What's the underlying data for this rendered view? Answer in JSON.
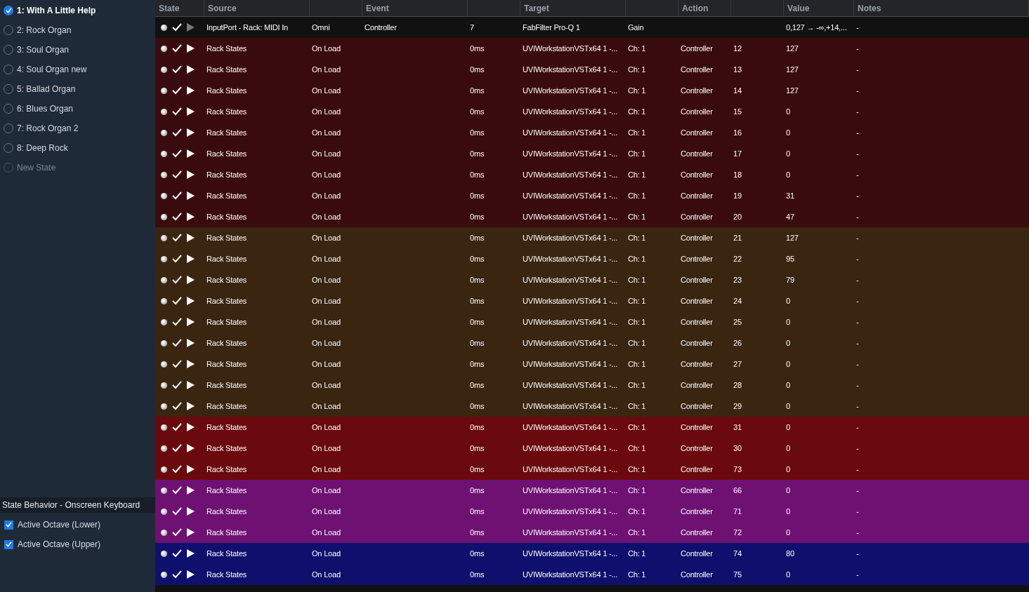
{
  "states": [
    {
      "label": "1: With A Little Help",
      "selected": true,
      "kind": "state"
    },
    {
      "label": "2: Rock Organ",
      "selected": false,
      "kind": "state"
    },
    {
      "label": "3: Soul Organ",
      "selected": false,
      "kind": "state"
    },
    {
      "label": "4: Soul Organ new",
      "selected": false,
      "kind": "state"
    },
    {
      "label": "5: Ballad Organ",
      "selected": false,
      "kind": "state"
    },
    {
      "label": "6: Blues Organ",
      "selected": false,
      "kind": "state"
    },
    {
      "label": "7: Rock Organ 2",
      "selected": false,
      "kind": "state"
    },
    {
      "label": "8: Deep Rock",
      "selected": false,
      "kind": "state"
    },
    {
      "label": "New State",
      "selected": false,
      "kind": "new"
    }
  ],
  "behavior": {
    "title": "State Behavior - Onscreen Keyboard",
    "options": [
      {
        "label": "Active Octave (Lower)",
        "checked": true
      },
      {
        "label": "Active Octave (Upper)",
        "checked": true
      }
    ]
  },
  "table": {
    "columns": [
      "State",
      "Source",
      "",
      "Event",
      "",
      "Target",
      "",
      "Action",
      "",
      "Value",
      "Notes"
    ],
    "rows": [
      {
        "color": "#111111",
        "playable": false,
        "cells": [
          "",
          "InputPort - Rack: MIDI In",
          "Omni",
          "Controller",
          "7",
          "FabFilter Pro-Q 1",
          "Gain",
          "",
          "",
          "0,127 → -∞,+14,...",
          "-"
        ]
      },
      {
        "color": "#3a0b0e",
        "playable": true,
        "cells": [
          "",
          "Rack States",
          "On Load",
          "",
          "0ms",
          "UVIWorkstationVSTx64 1 -...",
          "Ch: 1",
          "Controller",
          "12",
          "127",
          "-"
        ]
      },
      {
        "color": "#3a0b0e",
        "playable": true,
        "cells": [
          "",
          "Rack States",
          "On Load",
          "",
          "0ms",
          "UVIWorkstationVSTx64 1 -...",
          "Ch: 1",
          "Controller",
          "13",
          "127",
          "-"
        ]
      },
      {
        "color": "#3a0b0e",
        "playable": true,
        "cells": [
          "",
          "Rack States",
          "On Load",
          "",
          "0ms",
          "UVIWorkstationVSTx64 1 -...",
          "Ch: 1",
          "Controller",
          "14",
          "127",
          "-"
        ]
      },
      {
        "color": "#3a0b0e",
        "playable": true,
        "cells": [
          "",
          "Rack States",
          "On Load",
          "",
          "0ms",
          "UVIWorkstationVSTx64 1 -...",
          "Ch: 1",
          "Controller",
          "15",
          "0",
          "-"
        ]
      },
      {
        "color": "#3a0b0e",
        "playable": true,
        "cells": [
          "",
          "Rack States",
          "On Load",
          "",
          "0ms",
          "UVIWorkstationVSTx64 1 -...",
          "Ch: 1",
          "Controller",
          "16",
          "0",
          "-"
        ]
      },
      {
        "color": "#3a0b0e",
        "playable": true,
        "cells": [
          "",
          "Rack States",
          "On Load",
          "",
          "0ms",
          "UVIWorkstationVSTx64 1 -...",
          "Ch: 1",
          "Controller",
          "17",
          "0",
          "-"
        ]
      },
      {
        "color": "#3a0b0e",
        "playable": true,
        "cells": [
          "",
          "Rack States",
          "On Load",
          "",
          "0ms",
          "UVIWorkstationVSTx64 1 -...",
          "Ch: 1",
          "Controller",
          "18",
          "0",
          "-"
        ]
      },
      {
        "color": "#3a0b0e",
        "playable": true,
        "cells": [
          "",
          "Rack States",
          "On Load",
          "",
          "0ms",
          "UVIWorkstationVSTx64 1 -...",
          "Ch: 1",
          "Controller",
          "19",
          "31",
          "-"
        ]
      },
      {
        "color": "#3a0b0e",
        "playable": true,
        "cells": [
          "",
          "Rack States",
          "On Load",
          "",
          "0ms",
          "UVIWorkstationVSTx64 1 -...",
          "Ch: 1",
          "Controller",
          "20",
          "47",
          "-"
        ]
      },
      {
        "color": "#3a2511",
        "playable": true,
        "cells": [
          "",
          "Rack States",
          "On Load",
          "",
          "0ms",
          "UVIWorkstationVSTx64 1 -...",
          "Ch: 1",
          "Controller",
          "21",
          "127",
          "-"
        ]
      },
      {
        "color": "#3a2511",
        "playable": true,
        "cells": [
          "",
          "Rack States",
          "On Load",
          "",
          "0ms",
          "UVIWorkstationVSTx64 1 -...",
          "Ch: 1",
          "Controller",
          "22",
          "95",
          "-"
        ]
      },
      {
        "color": "#3a2511",
        "playable": true,
        "cells": [
          "",
          "Rack States",
          "On Load",
          "",
          "0ms",
          "UVIWorkstationVSTx64 1 -...",
          "Ch: 1",
          "Controller",
          "23",
          "79",
          "-"
        ]
      },
      {
        "color": "#3a2511",
        "playable": true,
        "cells": [
          "",
          "Rack States",
          "On Load",
          "",
          "0ms",
          "UVIWorkstationVSTx64 1 -...",
          "Ch: 1",
          "Controller",
          "24",
          "0",
          "-"
        ]
      },
      {
        "color": "#3a2511",
        "playable": true,
        "cells": [
          "",
          "Rack States",
          "On Load",
          "",
          "0ms",
          "UVIWorkstationVSTx64 1 -...",
          "Ch: 1",
          "Controller",
          "25",
          "0",
          "-"
        ]
      },
      {
        "color": "#3a2511",
        "playable": true,
        "cells": [
          "",
          "Rack States",
          "On Load",
          "",
          "0ms",
          "UVIWorkstationVSTx64 1 -...",
          "Ch: 1",
          "Controller",
          "26",
          "0",
          "-"
        ]
      },
      {
        "color": "#3a2511",
        "playable": true,
        "cells": [
          "",
          "Rack States",
          "On Load",
          "",
          "0ms",
          "UVIWorkstationVSTx64 1 -...",
          "Ch: 1",
          "Controller",
          "27",
          "0",
          "-"
        ]
      },
      {
        "color": "#3a2511",
        "playable": true,
        "cells": [
          "",
          "Rack States",
          "On Load",
          "",
          "0ms",
          "UVIWorkstationVSTx64 1 -...",
          "Ch: 1",
          "Controller",
          "28",
          "0",
          "-"
        ]
      },
      {
        "color": "#3a2511",
        "playable": true,
        "cells": [
          "",
          "Rack States",
          "On Load",
          "",
          "0ms",
          "UVIWorkstationVSTx64 1 -...",
          "Ch: 1",
          "Controller",
          "29",
          "0",
          "-"
        ]
      },
      {
        "color": "#6a0a0e",
        "playable": true,
        "cells": [
          "",
          "Rack States",
          "On Load",
          "",
          "0ms",
          "UVIWorkstationVSTx64 1 -...",
          "Ch: 1",
          "Controller",
          "31",
          "0",
          "-"
        ]
      },
      {
        "color": "#6a0a0e",
        "playable": true,
        "cells": [
          "",
          "Rack States",
          "On Load",
          "",
          "0ms",
          "UVIWorkstationVSTx64 1 -...",
          "Ch: 1",
          "Controller",
          "30",
          "0",
          "-"
        ]
      },
      {
        "color": "#6a0a0e",
        "playable": true,
        "cells": [
          "",
          "Rack States",
          "On Load",
          "",
          "0ms",
          "UVIWorkstationVSTx64 1 -...",
          "Ch: 1",
          "Controller",
          "73",
          "0",
          "-"
        ]
      },
      {
        "color": "#6e1173",
        "playable": true,
        "cells": [
          "",
          "Rack States",
          "On Load",
          "",
          "0ms",
          "UVIWorkstationVSTx64 1 -...",
          "Ch: 1",
          "Controller",
          "66",
          "0",
          "-"
        ]
      },
      {
        "color": "#6e1173",
        "playable": true,
        "cells": [
          "",
          "Rack States",
          "On Load",
          "",
          "0ms",
          "UVIWorkstationVSTx64 1 -...",
          "Ch: 1",
          "Controller",
          "71",
          "0",
          "-"
        ]
      },
      {
        "color": "#6e1173",
        "playable": true,
        "cells": [
          "",
          "Rack States",
          "On Load",
          "",
          "0ms",
          "UVIWorkstationVSTx64 1 -...",
          "Ch: 1",
          "Controller",
          "72",
          "0",
          "-"
        ]
      },
      {
        "color": "#0f0f6e",
        "playable": true,
        "cells": [
          "",
          "Rack States",
          "On Load",
          "",
          "0ms",
          "UVIWorkstationVSTx64 1 -...",
          "Ch: 1",
          "Controller",
          "74",
          "80",
          "-"
        ]
      },
      {
        "color": "#0f0f6e",
        "playable": true,
        "cells": [
          "",
          "Rack States",
          "On Load",
          "",
          "0ms",
          "UVIWorkstationVSTx64 1 -...",
          "Ch: 1",
          "Controller",
          "75",
          "0",
          "-"
        ]
      }
    ]
  }
}
